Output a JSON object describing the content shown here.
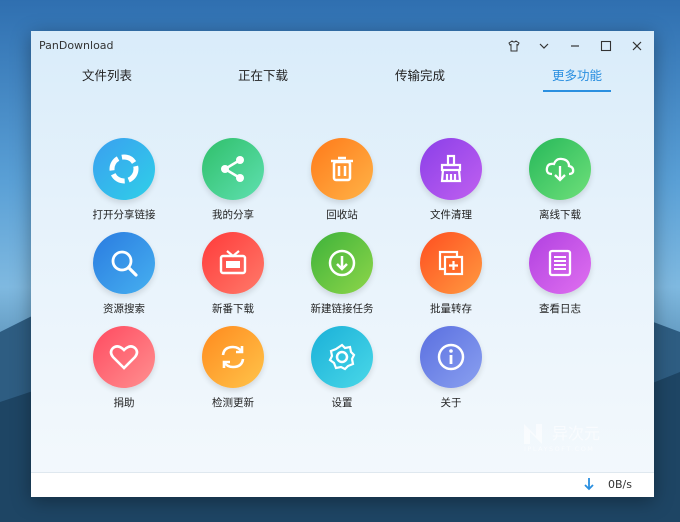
{
  "window": {
    "title": "PanDownload"
  },
  "tabs": [
    {
      "label": "文件列表"
    },
    {
      "label": "正在下载"
    },
    {
      "label": "传输完成"
    },
    {
      "label": "更多功能",
      "active": true
    }
  ],
  "features": [
    {
      "label": "打开分享链接",
      "icon": "ring-icon",
      "color": "#2fb8e6"
    },
    {
      "label": "我的分享",
      "icon": "share-icon",
      "color": "#3fcf8a"
    },
    {
      "label": "回收站",
      "icon": "trash-icon",
      "color": "#ff9a2e"
    },
    {
      "label": "文件清理",
      "icon": "broom-icon",
      "color": "#a24de8"
    },
    {
      "label": "离线下载",
      "icon": "cloud-download-icon",
      "color": "#39c66a"
    },
    {
      "label": "资源搜索",
      "icon": "search-icon",
      "color": "#2f8fe3"
    },
    {
      "label": "新番下载",
      "icon": "tv-icon",
      "color": "#f5485a"
    },
    {
      "label": "新建链接任务",
      "icon": "download-circle-icon",
      "color": "#5ec43f"
    },
    {
      "label": "批量转存",
      "icon": "copy-add-icon",
      "color": "#ff6a2a"
    },
    {
      "label": "查看日志",
      "icon": "list-icon",
      "color": "#c35ae6"
    },
    {
      "label": "捐助",
      "icon": "heart-icon",
      "color": "#ff6b7a"
    },
    {
      "label": "检测更新",
      "icon": "refresh-icon",
      "color": "#ffae38"
    },
    {
      "label": "设置",
      "icon": "gear-icon",
      "color": "#2ec5d8"
    },
    {
      "label": "关于",
      "icon": "info-icon",
      "color": "#6a7fe8"
    }
  ],
  "status": {
    "speed": "0B/s"
  },
  "watermark": {
    "cn": "异次元",
    "en": "IPLAYSOFT.COM"
  }
}
